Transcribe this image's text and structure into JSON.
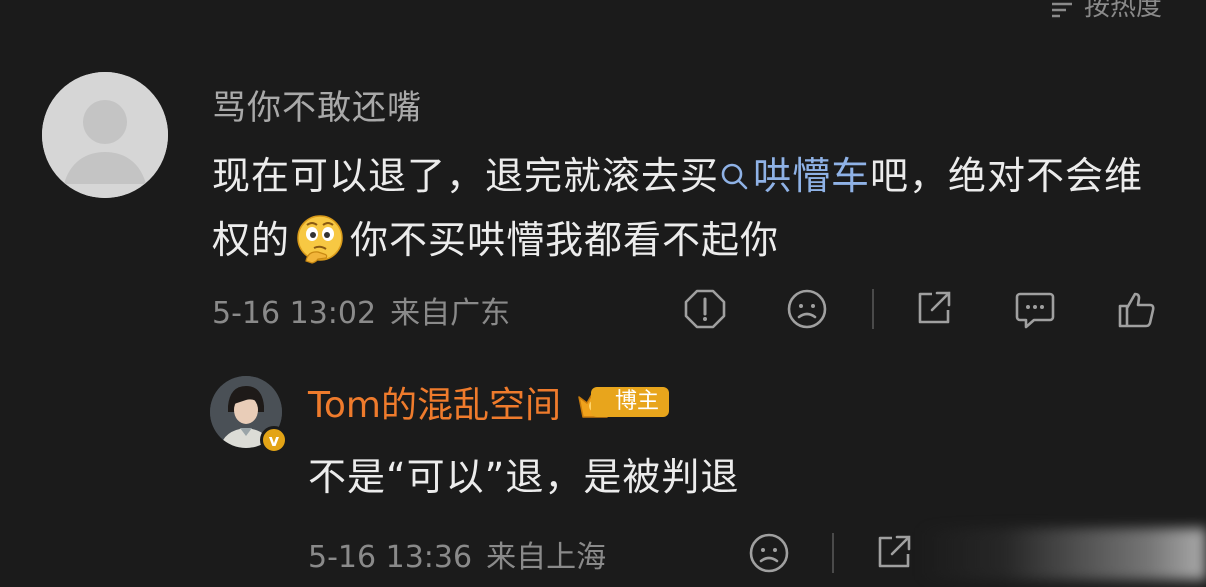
{
  "top_bar": {
    "sort_label": "按热度"
  },
  "comment": {
    "username": "骂你不敢还嘴",
    "text_part1": "现在可以退了，退完就滚去买",
    "link_text": "哄懵车",
    "text_part2": "吧，绝对不会维权的",
    "emoji_name": "thinking-emoji",
    "text_part3": "你不买哄懵我都看不起你",
    "timestamp": "5-16 13:02",
    "region": "来自广东"
  },
  "reply": {
    "username": "Tom的混乱空间",
    "badge": "博主",
    "text": "不是“可以”退，是被判退",
    "timestamp": "5-16 13:36",
    "region": "来自上海"
  },
  "colors": {
    "background": "#1b1b1b",
    "link": "#8fb2e6",
    "reply_username": "#ef7b2c",
    "badge": "#e8a51c"
  }
}
